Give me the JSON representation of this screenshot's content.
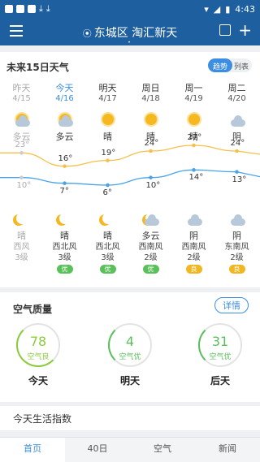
{
  "status_bar": {
    "time": "4:43"
  },
  "header": {
    "location": "东城区 淘汇新天"
  },
  "forecast": {
    "title": "未来15日天气",
    "toggle": {
      "on": "趋势",
      "off": "列表"
    },
    "days": [
      {
        "day": "昨天",
        "date": "4/15",
        "day_cond": "多云",
        "high": "23°",
        "low": "10°",
        "night_cond": "晴",
        "wind_dir": "西风",
        "wind_level": "3级",
        "aqi": "",
        "day_icon": "partly-cloudy-icon",
        "night_icon": "moon-icon"
      },
      {
        "day": "今天",
        "date": "4/16",
        "day_cond": "多云",
        "high": "16°",
        "low": "7°",
        "night_cond": "晴",
        "wind_dir": "西北风",
        "wind_level": "3级",
        "aqi": "优",
        "day_icon": "partly-cloudy-icon",
        "night_icon": "moon-icon"
      },
      {
        "day": "明天",
        "date": "4/17",
        "day_cond": "晴",
        "high": "19°",
        "low": "6°",
        "night_cond": "晴",
        "wind_dir": "西北风",
        "wind_level": "3级",
        "aqi": "优",
        "day_icon": "sun-icon",
        "night_icon": "moon-icon"
      },
      {
        "day": "周日",
        "date": "4/18",
        "day_cond": "晴",
        "high": "24°",
        "low": "10°",
        "night_cond": "多云",
        "wind_dir": "西南风",
        "wind_level": "2级",
        "aqi": "优",
        "day_icon": "sun-icon",
        "night_icon": "night-cloudy-icon"
      },
      {
        "day": "周一",
        "date": "4/19",
        "day_cond": "晴",
        "high": "27°",
        "low": "14°",
        "night_cond": "阴",
        "wind_dir": "西南风",
        "wind_level": "2级",
        "aqi": "良",
        "day_icon": "sun-icon",
        "night_icon": "cloud-icon"
      },
      {
        "day": "周二",
        "date": "4/20",
        "day_cond": "阴",
        "high": "24°",
        "low": "13°",
        "night_cond": "阴",
        "wind_dir": "东南风",
        "wind_level": "2级",
        "aqi": "良",
        "day_icon": "cloud-icon",
        "night_icon": "cloud-icon"
      }
    ],
    "high_values": [
      23,
      16,
      19,
      24,
      27,
      24
    ],
    "low_values": [
      10,
      7,
      6,
      10,
      14,
      13
    ],
    "colors": {
      "high_line": "#f5c04a",
      "low_line": "#4aa3e8",
      "aqi_good": "#5bbf5b",
      "aqi_moderate": "#f0b722"
    }
  },
  "air": {
    "title": "空气质量",
    "detail_label": "详情",
    "items": [
      {
        "value": "78",
        "label": "空气良",
        "day": "今天",
        "color": "#8bcc3a"
      },
      {
        "value": "4",
        "label": "空气优",
        "day": "明天",
        "color": "#5bbf5b"
      },
      {
        "value": "31",
        "label": "空气优",
        "day": "后天",
        "color": "#5bbf5b"
      }
    ]
  },
  "life": {
    "title": "今天生活指数"
  },
  "tabs": [
    "首页",
    "40日",
    "空气",
    "新闻"
  ]
}
